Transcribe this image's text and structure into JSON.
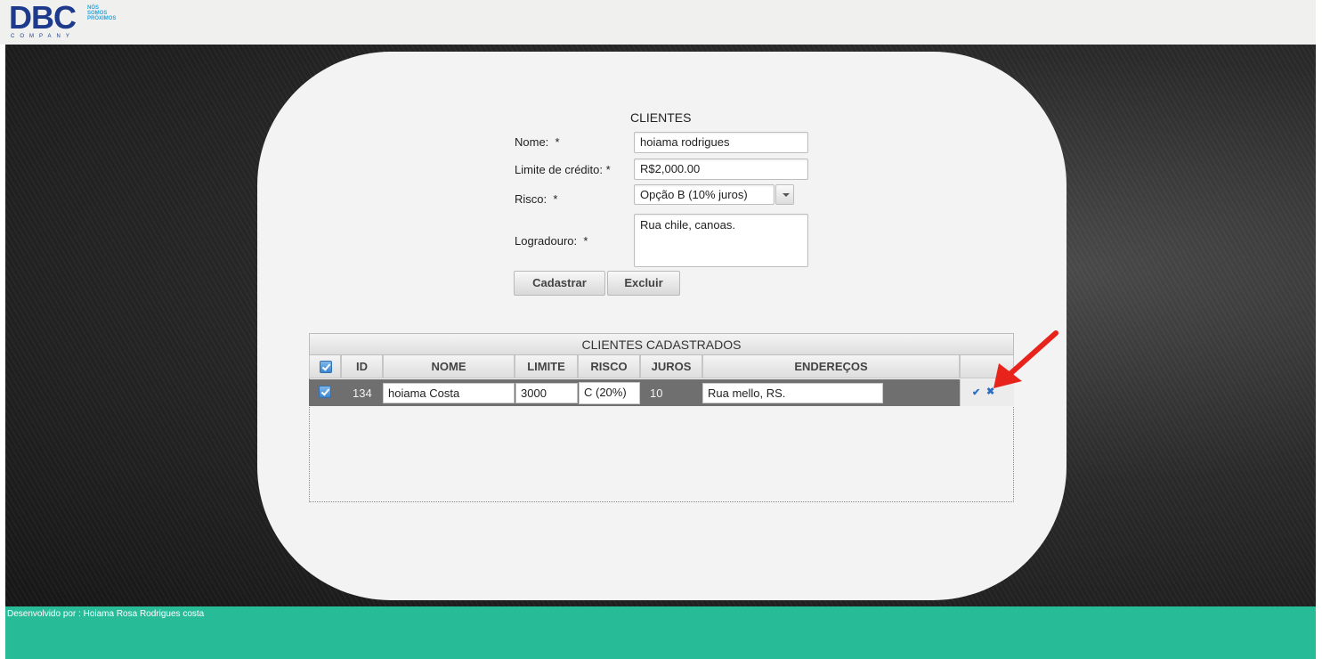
{
  "brand": {
    "logo": "DBC",
    "tagline": [
      "NÓS",
      "SOMOS",
      "PRÓXIMOS"
    ],
    "company": "COMPANY",
    "color": "#1d3a8c"
  },
  "form": {
    "title": "CLIENTES",
    "fields": {
      "nome": {
        "label": "Nome:",
        "required": "*",
        "value": "hoiama rodrigues"
      },
      "limite": {
        "label": "Limite de crédito:",
        "required": "*",
        "value": "R$2,000.00"
      },
      "risco": {
        "label": "Risco:",
        "required": "*",
        "value": "Opção B (10% juros)"
      },
      "logradouro": {
        "label": "Logradouro:",
        "required": "*",
        "value": "Rua chile, canoas."
      }
    },
    "buttons": {
      "cadastrar": "Cadastrar",
      "excluir": "Excluir"
    }
  },
  "table": {
    "caption": "CLIENTES CADASTRADOS",
    "columns": [
      "ID",
      "NOME",
      "LIMITE",
      "RISCO",
      "JUROS",
      "ENDEREÇOS"
    ],
    "rows": [
      {
        "selected": true,
        "id": "134",
        "nome": "hoiama Costa",
        "limite": "3000",
        "risco": "C (20%)",
        "juros": "10",
        "endereco": "Rua mello, RS.",
        "actions": [
          "check-icon",
          "close-icon"
        ]
      }
    ]
  },
  "annotation": {
    "color": "#e8231b",
    "icon": "arrow-icon"
  },
  "footer": {
    "text": "Desenvolvido por : Hoiama Rosa Rodrigues costa",
    "color": "#28bb98"
  }
}
